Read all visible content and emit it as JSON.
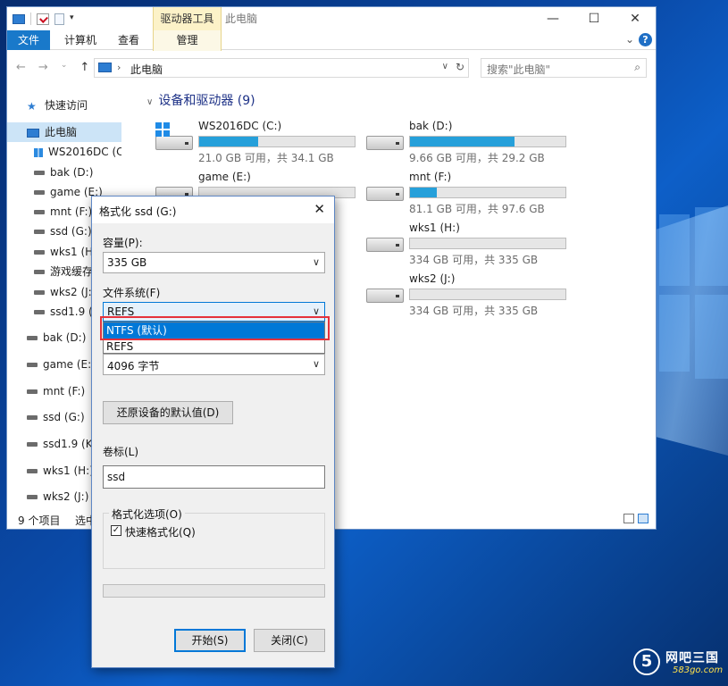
{
  "explorer": {
    "ribbon_context_tab": "驱动器工具",
    "title": "此电脑",
    "tabs": [
      "文件",
      "计算机",
      "查看",
      "管理"
    ],
    "address_path": "此电脑",
    "search_placeholder": "搜索\"此电脑\"",
    "window_controls": [
      "—",
      "☐",
      "✕"
    ],
    "nav_items": [
      {
        "label": "快速访问",
        "icon": "star-icon"
      },
      {
        "label": "此电脑",
        "icon": "computer-icon",
        "selected": true
      },
      {
        "label": "WS2016DC (C:)",
        "icon": "windows-drive-icon"
      },
      {
        "label": "bak (D:)",
        "icon": "drive-icon"
      },
      {
        "label": "game (E:)",
        "icon": "drive-icon"
      },
      {
        "label": "mnt (F:)",
        "icon": "drive-icon"
      },
      {
        "label": "ssd (G:)",
        "icon": "drive-icon"
      },
      {
        "label": "wks1 (H:",
        "icon": "drive-icon"
      },
      {
        "label": "游戏缓存",
        "icon": "drive-icon"
      },
      {
        "label": "wks2 (J:)",
        "icon": "drive-icon"
      },
      {
        "label": "ssd1.9 (K",
        "icon": "drive-icon"
      },
      {
        "label": "bak (D:)",
        "icon": "drive-icon"
      },
      {
        "label": "game (E:)",
        "icon": "drive-icon"
      },
      {
        "label": "mnt (F:)",
        "icon": "drive-icon"
      },
      {
        "label": "ssd (G:)",
        "icon": "drive-icon"
      },
      {
        "label": "ssd1.9 (K:)",
        "icon": "drive-icon"
      },
      {
        "label": "wks1 (H:)",
        "icon": "drive-icon"
      },
      {
        "label": "wks2 (J:)",
        "icon": "drive-icon"
      }
    ],
    "group_title": "设备和驱动器 (9)",
    "drives": [
      {
        "name": "WS2016DC (C:)",
        "info": "21.0 GB 可用，共 34.1 GB",
        "used_fraction": 0.38,
        "win": true
      },
      {
        "name": "bak (D:)",
        "info": "9.66 GB 可用，共 29.2 GB",
        "used_fraction": 0.67,
        "win": false
      },
      {
        "name": "game (E:)",
        "info": "",
        "used_fraction": 0.0,
        "win": false
      },
      {
        "name": "mnt (F:)",
        "info": "81.1 GB 可用，共 97.6 GB",
        "used_fraction": 0.17,
        "win": false
      },
      {
        "name": "wks1 (H:)",
        "info": "334 GB 可用，共 335 GB",
        "used_fraction": 0.0,
        "win": false
      },
      {
        "name": "wks2 (J:)",
        "info": "334 GB 可用，共 335 GB",
        "used_fraction": 0.0,
        "win": false
      }
    ],
    "status_count": "9 个项目",
    "status_selected": "选中"
  },
  "dialog": {
    "title": "格式化 ssd (G:)",
    "capacity_label": "容量(P):",
    "capacity_value": "335 GB",
    "fs_label": "文件系统(F)",
    "fs_value": "REFS",
    "fs_options": [
      "NTFS (默认)",
      "REFS"
    ],
    "alloc_value": "4096 字节",
    "restore_button": "还原设备的默认值(D)",
    "volume_label": "卷标(L)",
    "volume_value": "ssd",
    "options_legend": "格式化选项(O)",
    "quick_format": "快速格式化(Q)",
    "start_button": "开始(S)",
    "close_button": "关闭(C)"
  },
  "watermark": {
    "logo_char": "5",
    "name": "网吧三国",
    "url": "583go.com"
  },
  "colors": {
    "accent": "#0078d7",
    "file_tab": "#1979ca",
    "drive_bar": "#26a0da",
    "highlight_box": "#e5323c"
  }
}
